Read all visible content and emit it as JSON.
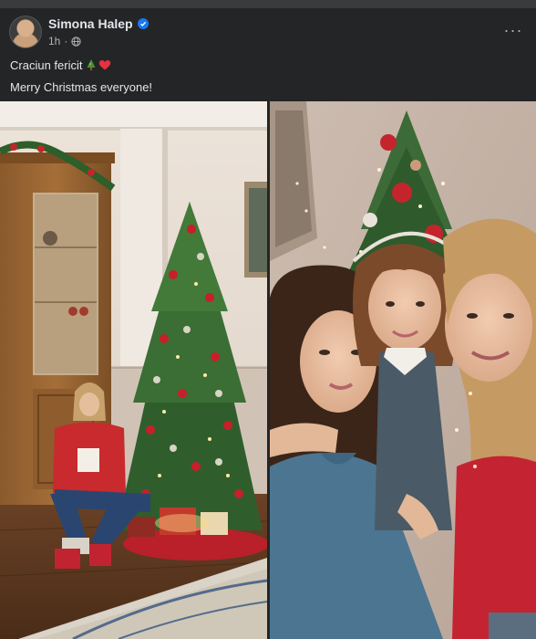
{
  "post": {
    "author": "Simona Halep",
    "timestamp": "1h",
    "privacy_icon": "globe-icon",
    "verified_icon": "verified-badge-icon",
    "more_icon": "more-options-icon",
    "more_label": "···",
    "text_line1": "Craciun fericit",
    "text_line1_emojis": [
      "christmas-tree-emoji",
      "red-heart-emoji"
    ],
    "text_line2": "Merry Christmas everyone!"
  },
  "photos": [
    {
      "id": "photo-1",
      "description_icon": "photo-christmas-tree-living-room"
    },
    {
      "id": "photo-2",
      "description_icon": "photo-family-selfie"
    }
  ],
  "colors": {
    "background": "#242526",
    "text": "#e4e6eb",
    "secondary_text": "#b0b3b8",
    "verified": "#1877f2"
  }
}
